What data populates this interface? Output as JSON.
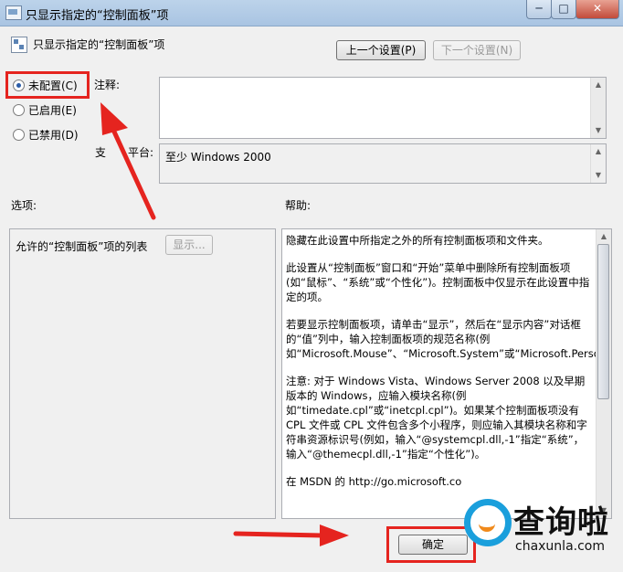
{
  "window": {
    "title": "只显示指定的“控制面板”项",
    "minimize_icon": "minimize-icon",
    "maximize_icon": "maximize-icon",
    "close_icon": "close-icon"
  },
  "header": {
    "title": "只显示指定的“控制面板”项",
    "prev_button": "上一个设置(P)",
    "next_button": "下一个设置(N)"
  },
  "state": {
    "options": [
      {
        "label": "未配置(C)",
        "checked": true
      },
      {
        "label": "已启用(E)",
        "checked": false
      },
      {
        "label": "已禁用(D)",
        "checked": false
      }
    ]
  },
  "comment": {
    "label": "注释:",
    "value": ""
  },
  "supported": {
    "label_partial_left": "支",
    "label_partial_right": "平台:",
    "value": "至少 Windows 2000"
  },
  "options_section": {
    "heading": "选项:",
    "list_label": "允许的“控制面板”项的列表",
    "show_button": "显示..."
  },
  "help_section": {
    "heading": "帮助:",
    "paragraphs": [
      "隐藏在此设置中所指定之外的所有控制面板项和文件夹。",
      "此设置从“控制面板”窗口和“开始”菜单中删除所有控制面板项(如“鼠标”、“系统”或“个性化”)。控制面板中仅显示在此设置中指定的项。",
      "若要显示控制面板项，请单击“显示”，然后在“显示内容”对话框的“值”列中，输入控制面板项的规范名称(例如“Microsoft.Mouse”、“Microsoft.System”或“Microsoft.Personalization”)。",
      "注意: 对于 Windows Vista、Windows Server 2008 以及早期版本的 Windows，应输入模块名称(例如“timedate.cpl”或“inetcpl.cpl”)。如果某个控制面板项没有 CPL 文件或 CPL 文件包含多个小程序，则应输入其模块名称和字符串资源标识号(例如，输入“@systemcpl.dll,-1”指定“系统”，输入“@themecpl.dll,-1”指定“个性化”)。",
      "在 MSDN 的 http://go.microsoft.co"
    ]
  },
  "footer": {
    "ok_button": "确定"
  },
  "watermark": {
    "brand_cn": "查询啦",
    "domain": "chaxunla.com"
  },
  "colors": {
    "annotation_red": "#e5241f",
    "brand_blue": "#1a9fdc",
    "brand_orange": "#f08a1c"
  }
}
